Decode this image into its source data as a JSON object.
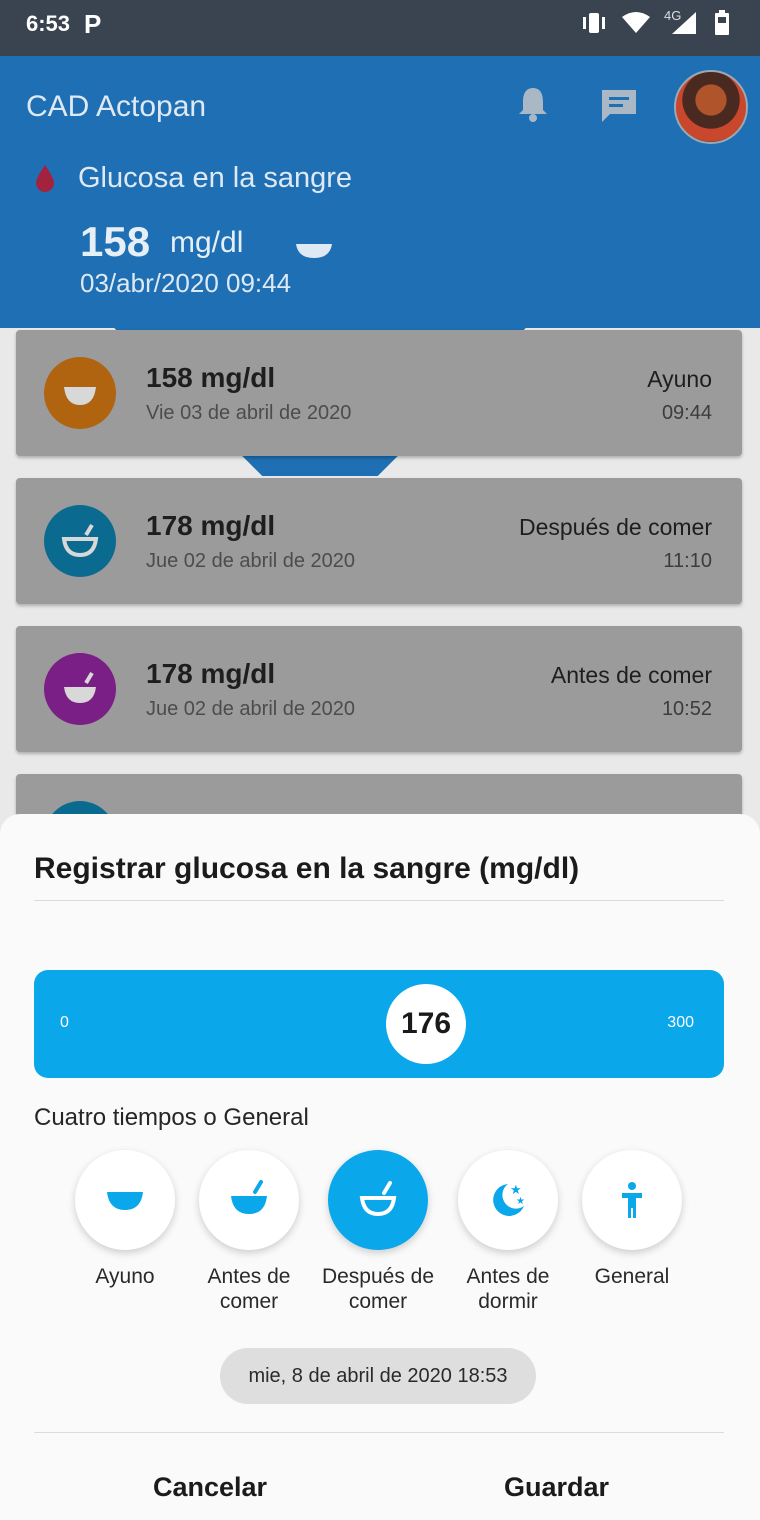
{
  "status_bar": {
    "time": "6:53",
    "network": "4G"
  },
  "app": {
    "title": "CAD Actopan",
    "glucose_label": "Glucosa en la sangre",
    "latest_value": "158",
    "latest_unit": "mg/dl",
    "latest_datetime": "03/abr/2020 09:44"
  },
  "records": [
    {
      "value": "158 mg/dl",
      "date": "Vie 03 de abril de 2020",
      "type": "Ayuno",
      "time": "09:44",
      "color": "#b06410"
    },
    {
      "value": "178 mg/dl",
      "date": "Jue 02 de abril de 2020",
      "type": "Después de comer",
      "time": "11:10",
      "color": "#0a6a90"
    },
    {
      "value": "178 mg/dl",
      "date": "Jue 02 de abril de 2020",
      "type": "Antes de comer",
      "time": "10:52",
      "color": "#7a1f86"
    }
  ],
  "sheet": {
    "title": "Registrar glucosa en la sangre (mg/dl)",
    "slider_min": "0",
    "slider_max": "300",
    "slider_value": "176",
    "section_label": "Cuatro tiempos o General",
    "options": [
      {
        "label": "Ayuno",
        "selected": false
      },
      {
        "label": "Antes de comer",
        "selected": false
      },
      {
        "label": "Después de comer",
        "selected": true
      },
      {
        "label": "Antes de dormir",
        "selected": false
      },
      {
        "label": "General",
        "selected": false
      }
    ],
    "datetime": "mie, 8 de abril de 2020 18:53",
    "cancel_label": "Cancelar",
    "save_label": "Guardar"
  },
  "colors": {
    "accent": "#0aa7ea",
    "header": "#1f6fb4"
  }
}
